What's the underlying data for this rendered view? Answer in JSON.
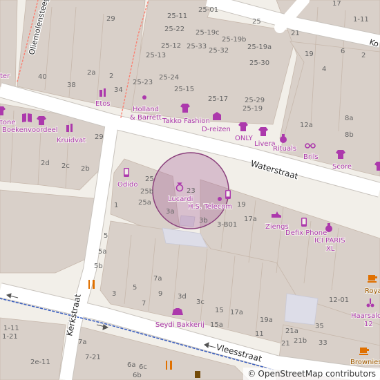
{
  "map": {
    "streets": [
      "Waterstraat",
      "Kerkstraat",
      "Vleesstraat",
      "Oliemolensteeg",
      "Ko"
    ],
    "pois": [
      {
        "name": "Etos",
        "icon": "pharmacy-icon"
      },
      {
        "name": "Holland & Barrett",
        "icon": "shop-dot-icon"
      },
      {
        "name": "Takko Fashion",
        "icon": "clothes-icon"
      },
      {
        "name": "D-reizen",
        "icon": "travel-agent-icon"
      },
      {
        "name": "ONLY",
        "icon": "clothes-icon"
      },
      {
        "name": "Livera",
        "icon": "clothes-icon"
      },
      {
        "name": "Rituals",
        "icon": "cosmetics-icon"
      },
      {
        "name": "Brils",
        "icon": "optician-icon"
      },
      {
        "name": "Score",
        "icon": "clothes-icon"
      },
      {
        "name": "Kruidvat",
        "icon": "pharmacy-icon"
      },
      {
        "name": "Boekenvoordeel",
        "icon": "books-icon"
      },
      {
        "name": "tone",
        "icon": "clothes-icon"
      },
      {
        "name": "Odido",
        "icon": "mobile-phone-icon"
      },
      {
        "name": "Lucardi",
        "icon": "jewelry-icon"
      },
      {
        "name": "H.S. Telecom",
        "icon": "mobile-phone-icon"
      },
      {
        "name": "Ziengs",
        "icon": "shoe-icon"
      },
      {
        "name": "Defix Phone",
        "icon": "mobile-phone-icon"
      },
      {
        "name": "ICI PARIS XL",
        "icon": "cosmetics-icon"
      },
      {
        "name": "Seydi Bakkerij",
        "icon": "bakery-icon"
      },
      {
        "name": "Roya",
        "icon": "cafe-icon"
      },
      {
        "name": "Haarsalon 12",
        "icon": "hairdresser-icon"
      },
      {
        "name": "Brownies",
        "icon": "cafe-icon"
      },
      {
        "name": "ter",
        "icon": ""
      }
    ],
    "house_numbers": [
      "29",
      "2a",
      "2",
      "40",
      "38",
      "34",
      "25-11",
      "25-01",
      "25-22",
      "25-19c",
      "25",
      "25-12",
      "25-33",
      "25-32",
      "25-19b",
      "25-19a",
      "25-13",
      "25-30",
      "25-24",
      "25-23",
      "25-15",
      "25-17",
      "25-29",
      "25-19",
      "12a",
      "8a",
      "8b",
      "29",
      "2d",
      "2c",
      "2b",
      "25",
      "25b",
      "25a",
      "1",
      "23",
      "3a",
      "19",
      "3b",
      "3-B01",
      "17a",
      "5",
      "5a",
      "5b",
      "7a",
      "3",
      "5",
      "9",
      "3d",
      "3c",
      "15",
      "7",
      "15a",
      "17a",
      "19a",
      "12-01",
      "1-11",
      "1-21",
      "7a",
      "7-21",
      "2e-11",
      "6a",
      "6c",
      "6b",
      "11",
      "21",
      "21a",
      "21b",
      "33",
      "35",
      "17",
      "1-11",
      "21",
      "19",
      "6",
      "4",
      "2"
    ],
    "footer": {
      "copyright": "©",
      "attribution": "OpenStreetMap contributors"
    },
    "colors": {
      "background": "#f2efe9",
      "building": "#d9d0c9",
      "road": "#ffffff",
      "poi": "#ac39ac",
      "highlight": "#a8689a"
    }
  }
}
